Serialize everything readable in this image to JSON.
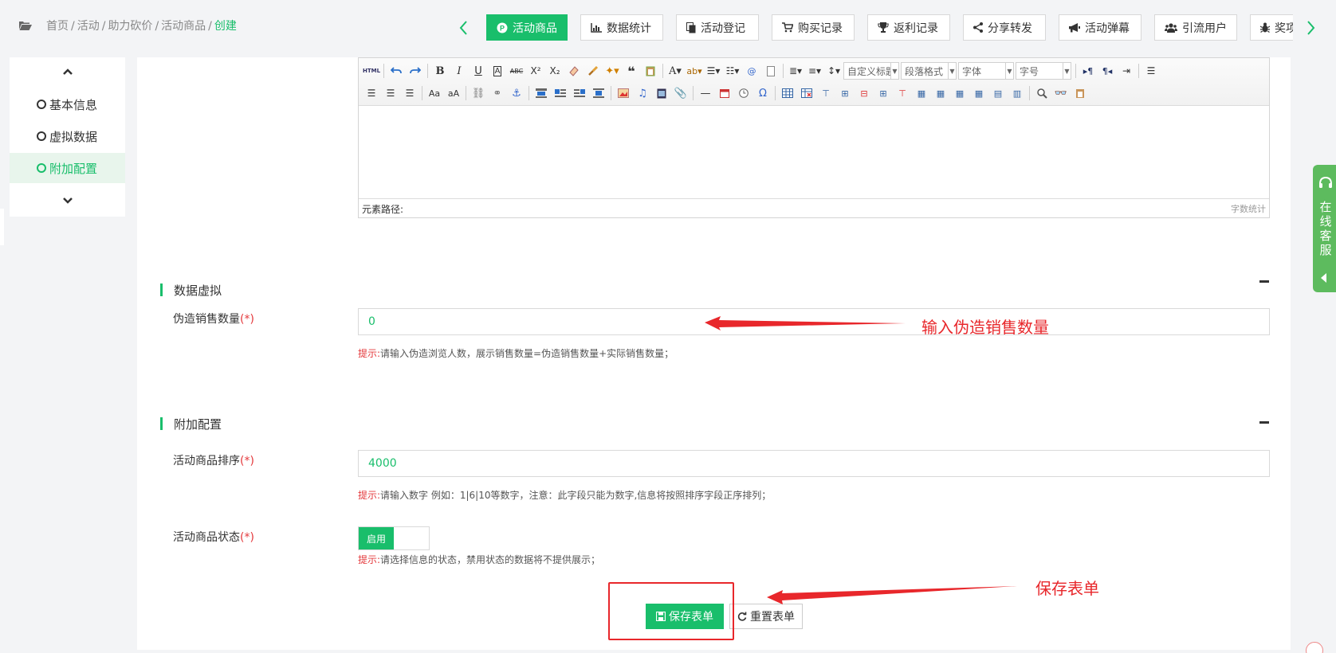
{
  "breadcrumb": {
    "items": [
      "首页",
      "活动",
      "助力砍价",
      "活动商品"
    ],
    "current": "创建"
  },
  "tabs": [
    {
      "label": "活动商品",
      "icon": "p-circle-icon",
      "active": true
    },
    {
      "label": "数据统计",
      "icon": "bar-chart-icon",
      "active": false
    },
    {
      "label": "活动登记",
      "icon": "copy-icon",
      "active": false
    },
    {
      "label": "购买记录",
      "icon": "cart-icon",
      "active": false
    },
    {
      "label": "返利记录",
      "icon": "trophy-icon",
      "active": false
    },
    {
      "label": "分享转发",
      "icon": "share-icon",
      "active": false
    },
    {
      "label": "活动弹幕",
      "icon": "bullhorn-icon",
      "active": false
    },
    {
      "label": "引流用户",
      "icon": "users-icon",
      "active": false
    },
    {
      "label": "奖项",
      "icon": "bug-icon",
      "active": false
    }
  ],
  "sidenav": {
    "items": [
      "基本信息",
      "虚拟数据",
      "附加配置"
    ],
    "active_index": 2
  },
  "editor": {
    "toolbar": {
      "custom_title": "自定义标题",
      "paragraph": "段落格式",
      "font": "字体",
      "size": "字号"
    },
    "footer_path": "元素路径:",
    "footer_count": "字数统计"
  },
  "section_virtual": {
    "title": "数据虚拟",
    "field_label": "伪造销售数量",
    "required": "(*)",
    "value": "0",
    "hint_prefix": "提示:",
    "hint": "请输入伪造浏览人数，展示销售数量=伪造销售数量+实际销售数量；"
  },
  "section_extra": {
    "title": "附加配置",
    "sort_label": "活动商品排序",
    "sort_required": "(*)",
    "sort_value": "4000",
    "sort_hint_prefix": "提示:",
    "sort_hint": "请输入数字 例如：1|6|10等数字，注意：此字段只能为数字,信息将按照排序字段正序排列；",
    "status_label": "活动商品状态",
    "status_required": "(*)",
    "status_on": "启用",
    "status_hint_prefix": "提示:",
    "status_hint": "请选择信息的状态，禁用状态的数据将不提供展示；"
  },
  "buttons": {
    "save": "保存表单",
    "reset": "重置表单"
  },
  "annotations": {
    "sales_note": "输入伪造销售数量",
    "save_note": "保存表单"
  },
  "service": {
    "label": "在线客服"
  },
  "colors": {
    "accent": "#19be6b",
    "annotation": "#e8272b",
    "required": "#e4393c"
  }
}
